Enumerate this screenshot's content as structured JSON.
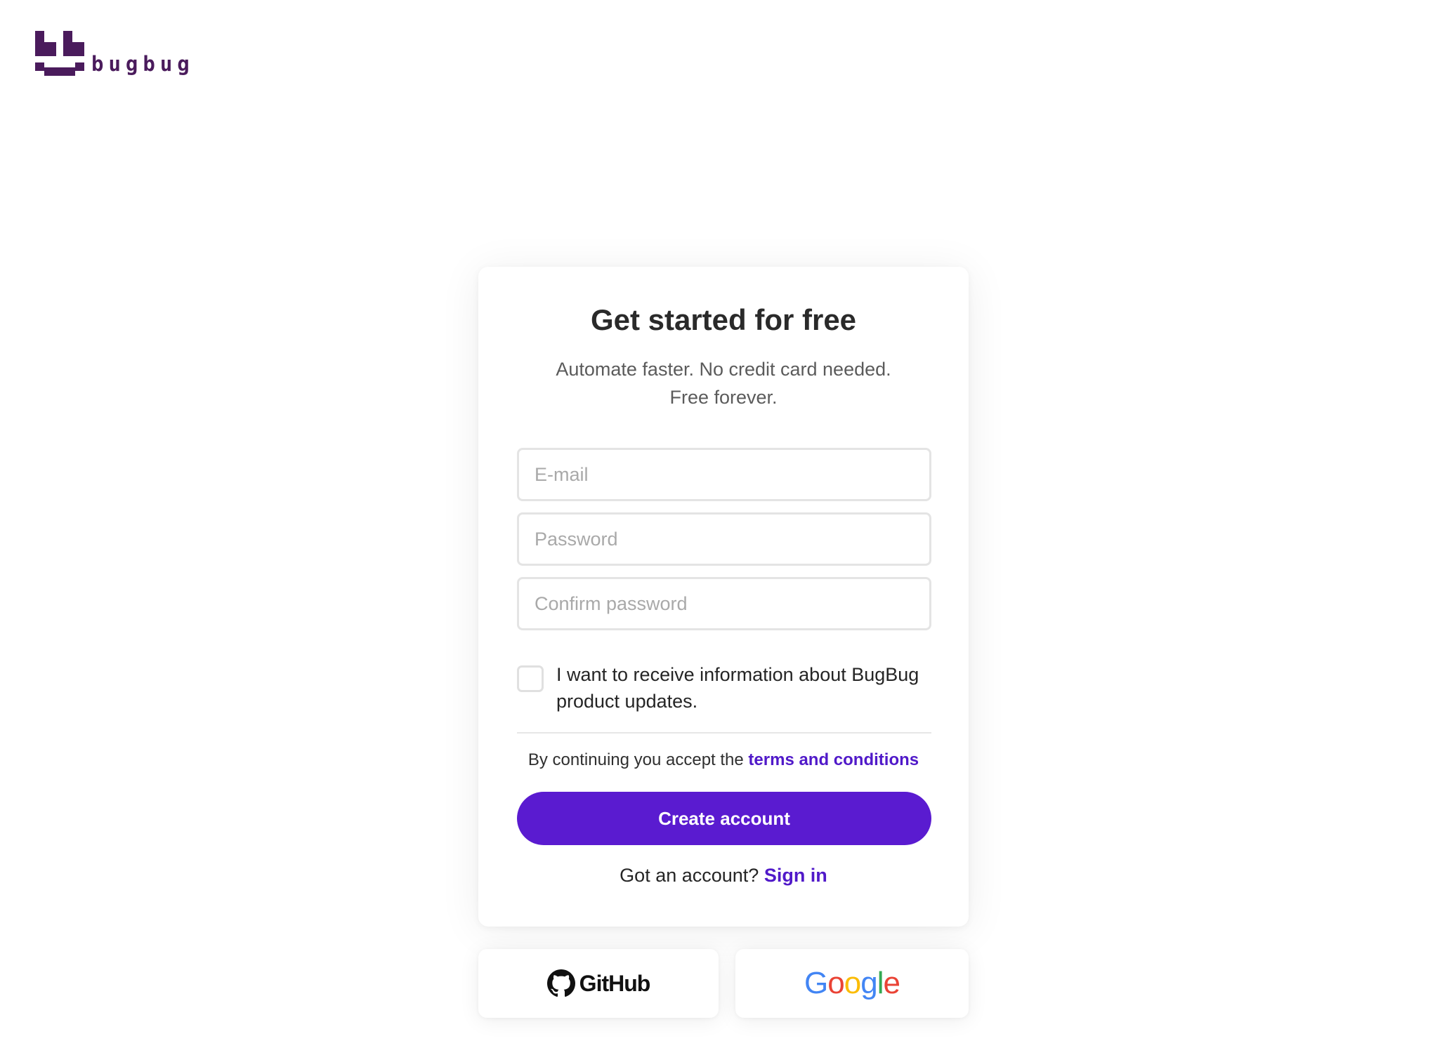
{
  "brand": {
    "name": "bugbug",
    "color": "#4a1b5c"
  },
  "signup": {
    "title": "Get started for free",
    "subtitle_line1": "Automate faster. No credit card needed.",
    "subtitle_line2": "Free forever.",
    "email_placeholder": "E-mail",
    "password_placeholder": "Password",
    "confirm_placeholder": "Confirm password",
    "email_value": "",
    "password_value": "",
    "confirm_value": "",
    "updates_checked": false,
    "updates_label": "I want to receive information about BugBug product updates.",
    "terms_prefix": "By continuing you accept the ",
    "terms_link": "terms and conditions",
    "create_button": "Create account",
    "signin_prefix": "Got an account? ",
    "signin_link": "Sign in"
  },
  "social": {
    "github_label": "GitHub",
    "github_icon": "github-octocat-icon",
    "google_label": "Google",
    "google_letters": [
      {
        "ch": "G",
        "color": "#4285F4"
      },
      {
        "ch": "o",
        "color": "#EA4335"
      },
      {
        "ch": "o",
        "color": "#FBBC05"
      },
      {
        "ch": "g",
        "color": "#4285F4"
      },
      {
        "ch": "l",
        "color": "#34A853"
      },
      {
        "ch": "e",
        "color": "#EA4335"
      }
    ]
  },
  "colors": {
    "accent": "#5a1bd0",
    "link": "#5019c9"
  }
}
